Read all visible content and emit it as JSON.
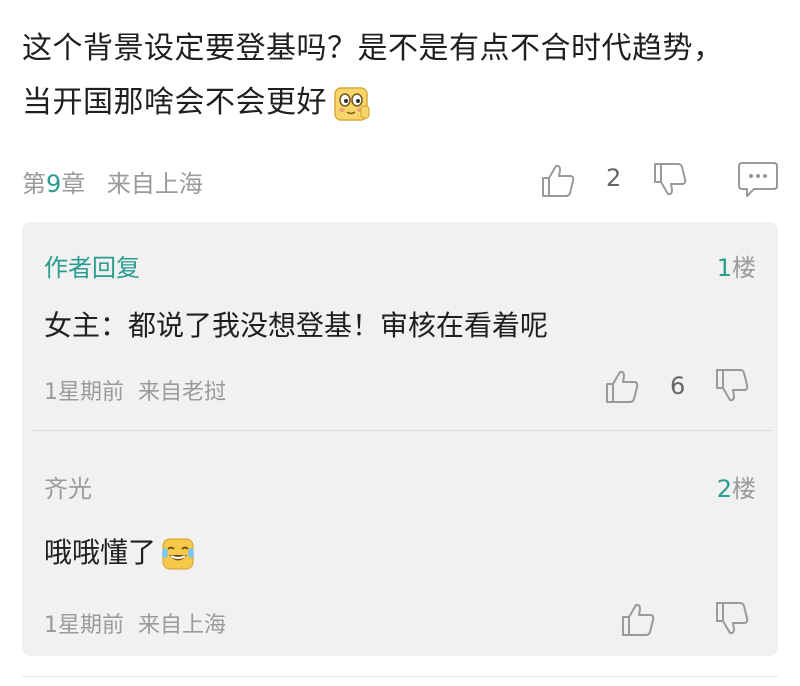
{
  "comment": {
    "line1": "这个背景设定要登基吗？是不是有点不合时代趋势，",
    "line2": "当开国那啥会不会更好",
    "emoji_icon": "shy-face-emoji",
    "chapter_prefix": "第",
    "chapter_num": "9",
    "chapter_suffix": "章",
    "location": "来自上海",
    "like_count": "2"
  },
  "replies": [
    {
      "author": "作者回复",
      "author_color": "#2a9d8f",
      "floor_num": "1",
      "floor_word": "楼",
      "text": "女主：都说了我没想登基！审核在看着呢",
      "time": "1星期前",
      "location": "来自老挝",
      "like_count": "6"
    },
    {
      "author": "齐光",
      "author_color": "#9a9a9a",
      "floor_num": "2",
      "floor_word": "楼",
      "text": "哦哦懂了",
      "emoji_icon": "tears-of-joy-emoji",
      "time": "1星期前",
      "location": "来自上海",
      "like_count": ""
    }
  ],
  "colors": {
    "accent": "#2a9d8f",
    "muted": "#9a9a9a",
    "reply_bg": "#f1f1f1"
  }
}
